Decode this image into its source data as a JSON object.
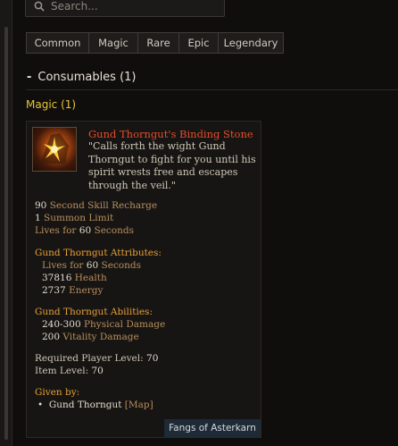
{
  "search": {
    "placeholder": "Search..."
  },
  "tabs": [
    {
      "label": "Common"
    },
    {
      "label": "Magic"
    },
    {
      "label": "Rare"
    },
    {
      "label": "Epic"
    },
    {
      "label": "Legendary"
    }
  ],
  "section": {
    "dash": "-",
    "title": "Consumables (1)"
  },
  "rarity_group": {
    "title": "Magic (1)"
  },
  "item": {
    "name": "Gund Thorngut's Binding Stone",
    "description": "\"Calls forth the wight Gund Thorngut to fight for you until his spirit wrests free and escapes through the veil.\"",
    "recharge": {
      "value": "90",
      "label": "Second Skill Recharge"
    },
    "summon_limit": {
      "value": "1",
      "label": "Summon Limit"
    },
    "lives_for": {
      "label": "Lives for",
      "value": "60",
      "unit": "Seconds"
    },
    "attributes_heading": "Gund Thorngut Attributes:",
    "attr_lives": {
      "label": "Lives for",
      "value": "60",
      "unit": "Seconds"
    },
    "attr_health": {
      "value": "37816",
      "label": "Health"
    },
    "attr_energy": {
      "value": "2737",
      "label": "Energy"
    },
    "abilities_heading": "Gund Thorngut Abilities:",
    "ability_physical": {
      "value": "240-300",
      "label": "Physical Damage"
    },
    "ability_vitality": {
      "value": "200",
      "label": "Vitality Damage"
    },
    "required_level": {
      "label": "Required Player Level:",
      "value": "70"
    },
    "item_level": {
      "label": "Item Level:",
      "value": "70"
    },
    "given_by_heading": "Given by:",
    "given_by": {
      "name": "Gund Thorngut",
      "link": "[Map]"
    },
    "badge": "Fangs of Asterkarn"
  }
}
